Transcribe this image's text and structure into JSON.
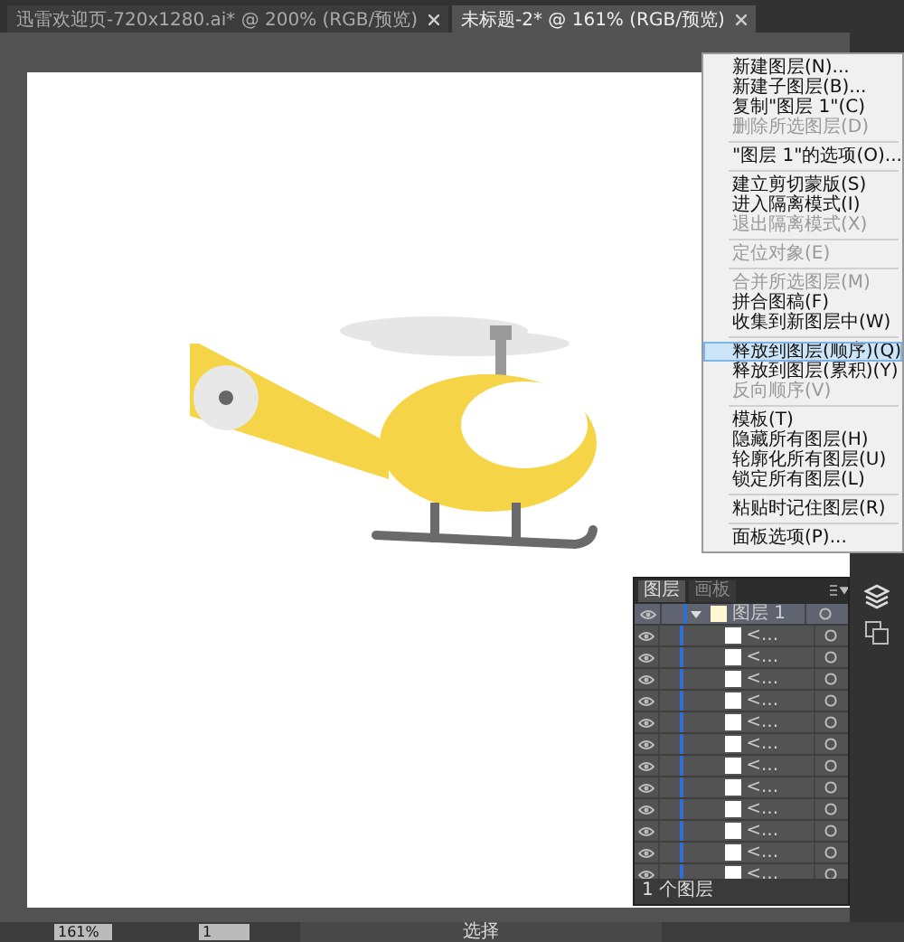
{
  "document_tabs": [
    {
      "title": "迅雷欢迎页-720x1280.ai* @ 200% (RGB/预览)",
      "selected": false
    },
    {
      "title": "未标题-2* @ 161% (RGB/预览)",
      "selected": true
    }
  ],
  "context_menu": {
    "groups": [
      [
        {
          "label": "新建图层(N)...",
          "disabled": false,
          "selected": false
        },
        {
          "label": "新建子图层(B)...",
          "disabled": false,
          "selected": false
        },
        {
          "label": "复制\"图层 1\"(C)",
          "disabled": false,
          "selected": false
        },
        {
          "label": "删除所选图层(D)",
          "disabled": true,
          "selected": false
        }
      ],
      [
        {
          "label": "\"图层 1\"的选项(O)...",
          "disabled": false,
          "selected": false
        }
      ],
      [
        {
          "label": "建立剪切蒙版(S)",
          "disabled": false,
          "selected": false
        },
        {
          "label": "进入隔离模式(I)",
          "disabled": false,
          "selected": false
        },
        {
          "label": "退出隔离模式(X)",
          "disabled": true,
          "selected": false
        }
      ],
      [
        {
          "label": "定位对象(E)",
          "disabled": true,
          "selected": false
        }
      ],
      [
        {
          "label": "合并所选图层(M)",
          "disabled": true,
          "selected": false
        },
        {
          "label": "拼合图稿(F)",
          "disabled": false,
          "selected": false
        },
        {
          "label": "收集到新图层中(W)",
          "disabled": false,
          "selected": false
        }
      ],
      [
        {
          "label": "释放到图层(顺序)(Q)",
          "disabled": false,
          "selected": true
        },
        {
          "label": "释放到图层(累积)(Y)",
          "disabled": false,
          "selected": false
        },
        {
          "label": "反向顺序(V)",
          "disabled": true,
          "selected": false
        }
      ],
      [
        {
          "label": "模板(T)",
          "disabled": false,
          "selected": false
        },
        {
          "label": "隐藏所有图层(H)",
          "disabled": false,
          "selected": false
        },
        {
          "label": "轮廓化所有图层(U)",
          "disabled": false,
          "selected": false
        },
        {
          "label": "锁定所有图层(L)",
          "disabled": false,
          "selected": false
        }
      ],
      [
        {
          "label": "粘贴时记住图层(R)",
          "disabled": false,
          "selected": false
        }
      ],
      [
        {
          "label": "面板选项(P)...",
          "disabled": false,
          "selected": false
        }
      ]
    ]
  },
  "layers_panel": {
    "tabs": [
      {
        "label": "图层",
        "selected": true
      },
      {
        "label": "画板",
        "selected": false
      }
    ],
    "layers": [
      {
        "name": "图层 1",
        "expanded": true,
        "children": [
          {
            "name": "<..."
          },
          {
            "name": "<..."
          },
          {
            "name": "<..."
          },
          {
            "name": "<..."
          },
          {
            "name": "<..."
          },
          {
            "name": "<..."
          },
          {
            "name": "<..."
          },
          {
            "name": "<..."
          },
          {
            "name": "<..."
          },
          {
            "name": "<..."
          },
          {
            "name": "<..."
          },
          {
            "name": "<..."
          }
        ]
      }
    ],
    "footer": "1 个图层"
  },
  "status_bar": {
    "zoom": "161%",
    "page": "1",
    "tool": "选择"
  }
}
